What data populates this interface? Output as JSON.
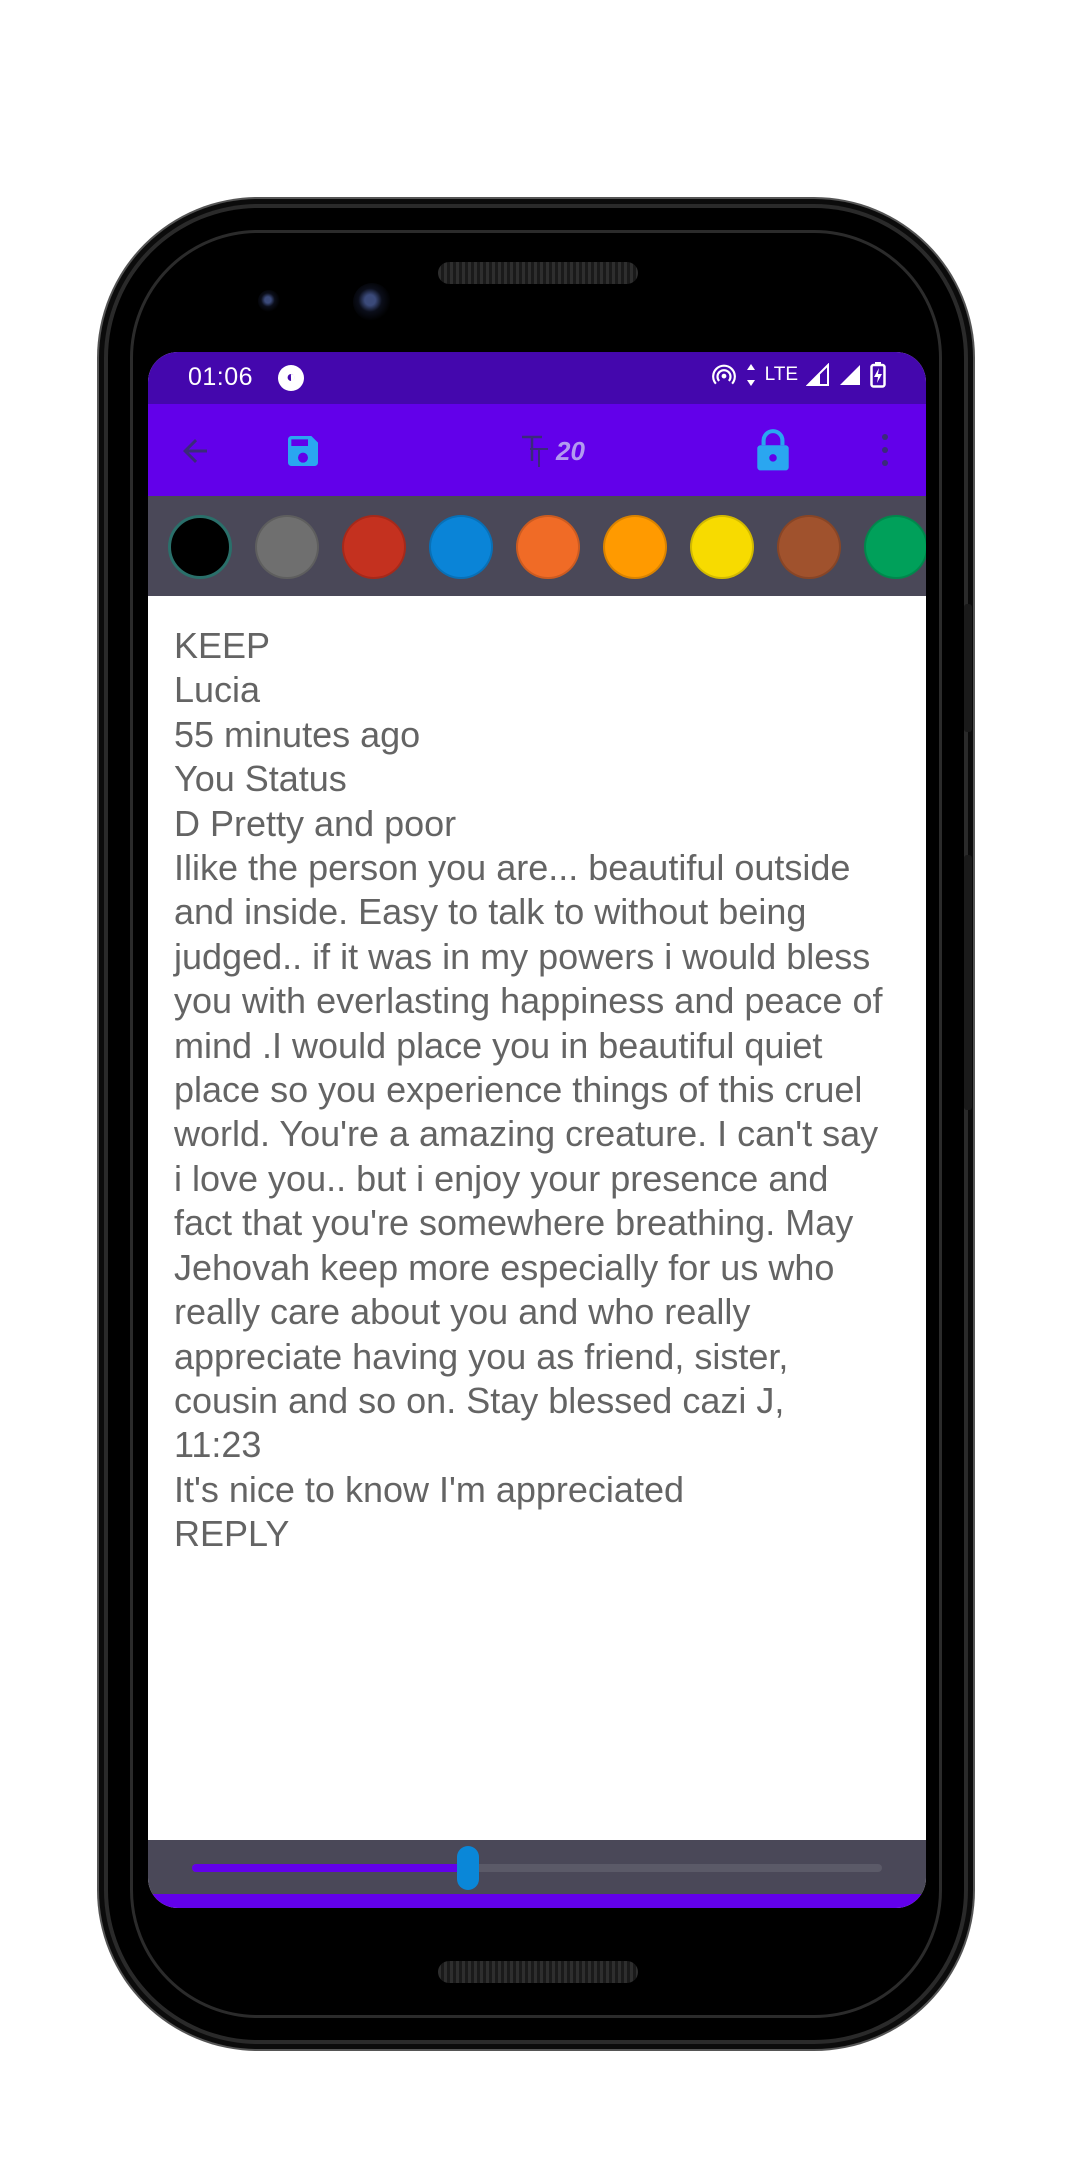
{
  "status_bar": {
    "time": "01:06",
    "network_label": "LTE"
  },
  "toolbar": {
    "font_size": "20",
    "icons": [
      "back-arrow-icon",
      "save-icon",
      "font-size-icon",
      "lock-icon",
      "more-vertical-icon"
    ]
  },
  "color_palette": {
    "swatches": [
      "#000000",
      "#6f6f6f",
      "#c4311f",
      "#0a84d7",
      "#f06b26",
      "#ff9a00",
      "#f7db00",
      "#a0522d",
      "#00a05a"
    ]
  },
  "note": {
    "text": "KEEP\nLucia\n55 minutes ago\nYou Status\nD Pretty and poor\nIlike the person you are... beautiful outside and inside. Easy to talk to without being judged.. if it was in my powers i would bless you with everlasting happiness and peace of mind .I would place you in beautiful quiet place so you experience things of this cruel world. You're a amazing creature. I can't say i love you.. but i enjoy your presence and fact that you're somewhere breathing. May Jehovah keep more especially for us who really care about you and who really appreciate having you as friend, sister, cousin and so on. Stay blessed cazi J,\n11:23\nIt's nice to know I'm appreciated\nREPLY"
  },
  "slider": {
    "value_fraction": 0.4
  },
  "colors": {
    "status_bar": "#4407ad",
    "toolbar": "#6200ea",
    "toolbar_icon": "#2aa6f0",
    "palette_bg": "#4a4858",
    "text": "#646464",
    "slider_thumb": "#0a87d8"
  }
}
